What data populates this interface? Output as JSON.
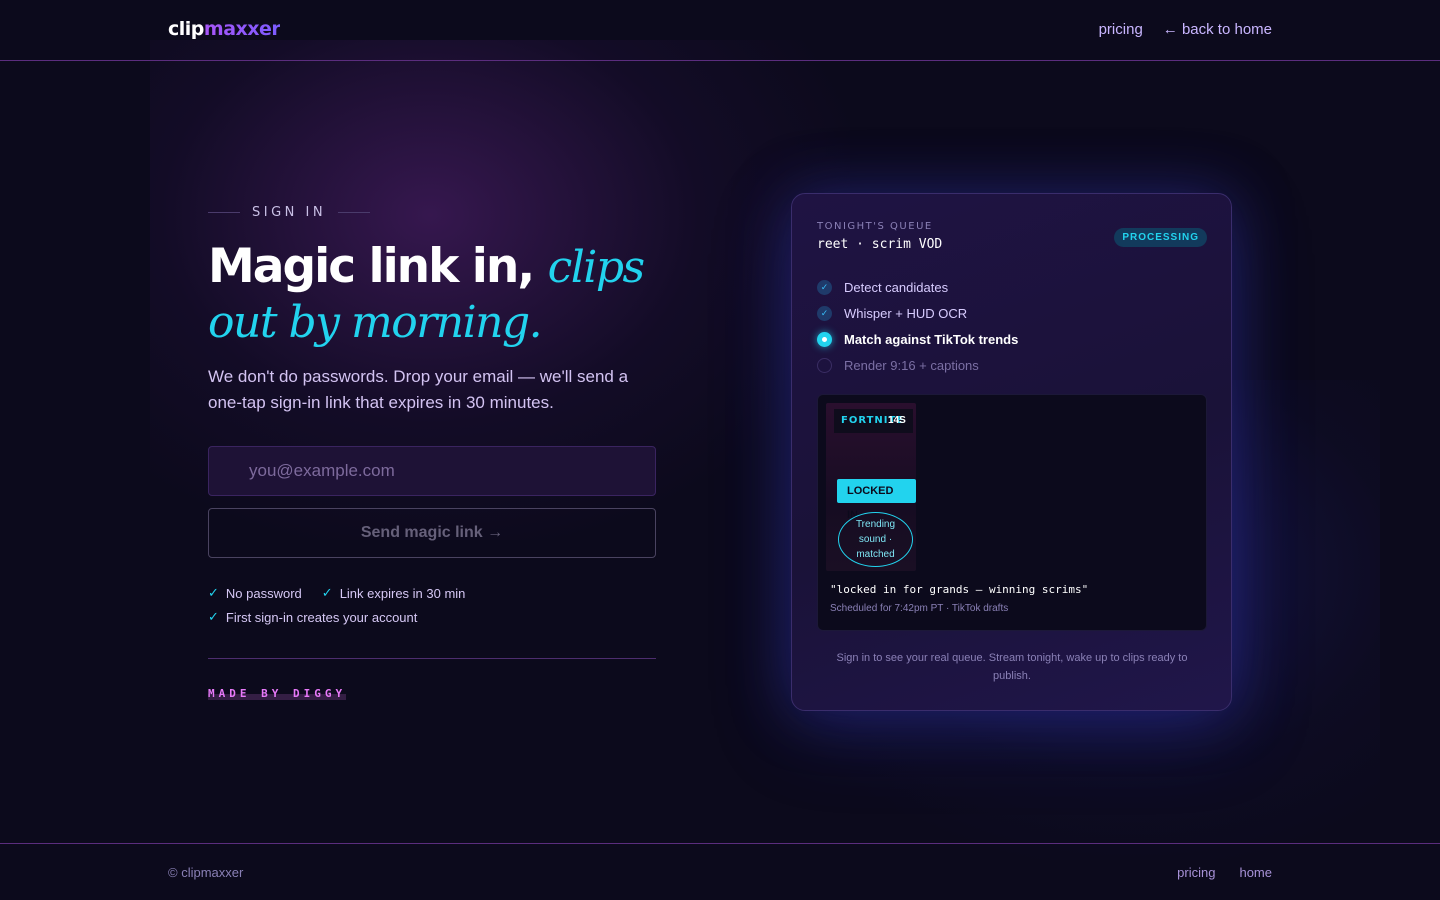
{
  "header": {
    "logo_part1": "clip",
    "logo_part2": "maxxer",
    "nav_pricing": "pricing",
    "nav_back": "← back to home"
  },
  "signin": {
    "eyebrow": "SIGN IN",
    "headline_plain": "Magic link in, ",
    "headline_accent": "clips out by morning.",
    "subtitle": "We don't do passwords. Drop your email — we'll send a one-tap sign-in link that expires in 30 minutes.",
    "email_placeholder": "you@example.com",
    "send_button": "Send magic link →",
    "perks": [
      "No password",
      "Link expires in 30 min",
      "First sign-in creates your account"
    ],
    "made_by": "MADE BY DIGGY"
  },
  "queue_card": {
    "label": "TONIGHT'S QUEUE",
    "title": "reet · scrim VOD",
    "status_badge": "PROCESSING",
    "steps": [
      {
        "label": "Detect candidates",
        "state": "done"
      },
      {
        "label": "Whisper + HUD OCR",
        "state": "done"
      },
      {
        "label": "Match against TikTok trends",
        "state": "active"
      },
      {
        "label": "Render 9:16 + captions",
        "state": "pending"
      }
    ],
    "clip": {
      "game_tag": "FORTNITE",
      "timecode": "14S",
      "locked_tag": "LOCKED IN",
      "sound_line1": "Trending",
      "sound_line2": "sound ·",
      "sound_line3": "matched",
      "caption": "\"locked in for grands — winning scrims\"",
      "meta": "Scheduled for 7:42pm PT · TikTok drafts"
    },
    "footer_note": "Sign in to see your real queue. Stream tonight, wake up to clips ready to publish."
  },
  "footer": {
    "copyright": "© clipmaxxer",
    "link_pricing": "pricing",
    "link_home": "home"
  },
  "colors": {
    "accent_cyan": "#22d3ee",
    "accent_purple": "#a855f7",
    "background": "#0c0a1c"
  }
}
